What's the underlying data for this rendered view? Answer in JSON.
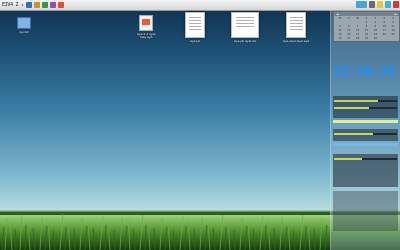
{
  "topbar": {
    "quick_launch_text": "EIV4 Z ↓",
    "icons": [
      "home-icon",
      "user-icon",
      "web-icon",
      "settings-icon",
      "power-icon"
    ],
    "tray_icons": [
      "laptop-icon",
      "network-icon",
      "note-icon",
      "messenger-icon",
      "antivirus-icon"
    ]
  },
  "desktop": {
    "icons": [
      {
        "label": "Ayx42"
      },
      {
        "label": "Aya 5.2 Ayar\nNaş Aya"
      },
      {
        "label": "Aya Jai"
      },
      {
        "label": "Aya Jai Ayal.de"
      },
      {
        "label": "Aya Ayal Ayal Aya"
      }
    ]
  },
  "sidebar": {
    "calendar": {
      "header_left": "◄",
      "header_center": "",
      "header_right": "►",
      "weekdays": [
        "M",
        "T",
        "W",
        "T",
        "F",
        "S",
        "S"
      ],
      "days": [
        "",
        "",
        "",
        "1",
        "2",
        "3",
        "4",
        "5",
        "6",
        "7",
        "8",
        "9",
        "10",
        "11",
        "12",
        "13",
        "14",
        "15",
        "16",
        "17",
        "18",
        "19",
        "20",
        "21",
        "22",
        "23",
        "24",
        "25",
        "26",
        "27",
        "28",
        "29",
        "30",
        "",
        ""
      ]
    },
    "clock": "22:38:35",
    "cpu_rows": [
      {
        "label": "",
        "value": ""
      },
      {
        "label": "",
        "value": ""
      },
      {
        "label": "",
        "value": ""
      }
    ],
    "mem_rows": [
      {
        "label": "",
        "value": ""
      },
      {
        "label": "",
        "value": ""
      }
    ],
    "net_rows": [
      {
        "label": "",
        "value": ""
      },
      {
        "label": "",
        "value": ""
      },
      {
        "label": "",
        "value": ""
      },
      {
        "label": "",
        "value": ""
      },
      {
        "label": "",
        "value": ""
      },
      {
        "label": "",
        "value": ""
      },
      {
        "label": "",
        "value": ""
      },
      {
        "label": "",
        "value": ""
      }
    ],
    "progress": {
      "cpu_bar": 0.7,
      "ram_bar": 0.55,
      "disk_bar": 0.62,
      "hd_bar": 0.45
    },
    "legend_red": "",
    "legend_blue": ""
  },
  "colors": {
    "clock": "#1e90ff",
    "bar": "#c5d65a",
    "ribbon": "#e0f08c",
    "ribbon2": "#77b8e8"
  }
}
